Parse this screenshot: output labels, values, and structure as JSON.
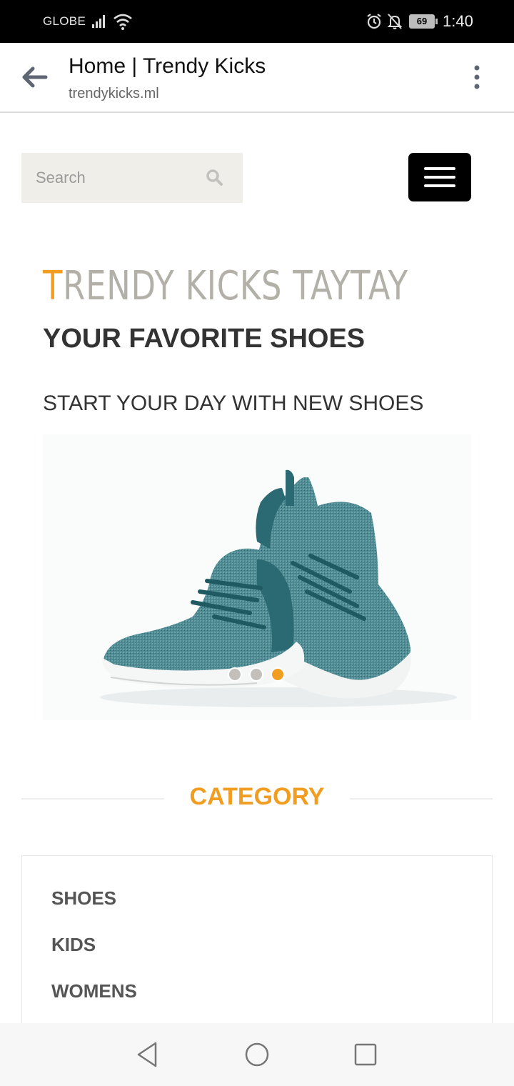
{
  "status_bar": {
    "carrier": "GLOBE",
    "battery": "69",
    "time": "1:40"
  },
  "browser": {
    "title": "Home | Trendy Kicks",
    "url": "trendykicks.ml"
  },
  "search": {
    "placeholder": "Search"
  },
  "hero": {
    "brand_first_letter": "T",
    "brand_rest": "RENDY KICKS TAYTAY",
    "tagline": "YOUR FAVORITE SHOES",
    "subtitle": "START YOUR DAY WITH NEW SHOES"
  },
  "carousel": {
    "slide_count": 3,
    "active_slide": 3
  },
  "category": {
    "heading": "CATEGORY",
    "items": [
      "SHOES",
      "KIDS",
      "WOMENS"
    ]
  },
  "colors": {
    "accent": "#f19d22",
    "brand_gray": "#b3b0a8",
    "shoe_teal": "#3f7d85"
  }
}
